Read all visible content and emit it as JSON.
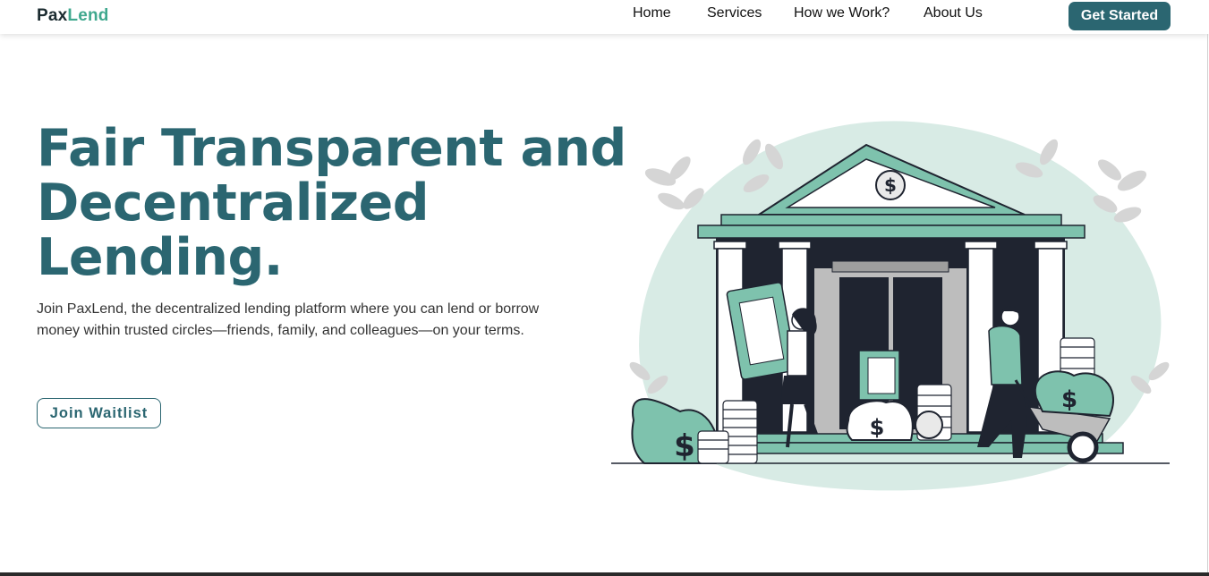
{
  "brand": {
    "part1": "Pax",
    "part2": "Lend"
  },
  "nav": {
    "links": [
      "Home",
      "Services",
      "How we Work?",
      "About Us"
    ],
    "cta": "Get Started"
  },
  "hero": {
    "title_lines": [
      "Fair Transparent and",
      "Decentralized",
      "Lending."
    ],
    "description": "Join PaxLend, the decentralized lending platform where you can lend or borrow money within trusted circles—friends, family, and colleagues—on your terms.",
    "cta": "Join Waitlist"
  },
  "illustration": {
    "bank_sign": "$",
    "bag_signs": [
      "$",
      "$",
      "$"
    ],
    "colors": {
      "blob": "#d8ebe5",
      "accent": "#7ec2ad",
      "dark": "#1f2430",
      "leaf": "#d5d5d5"
    }
  },
  "colors": {
    "brand_dark": "#2b6671",
    "brand_green": "#3fa88e"
  }
}
